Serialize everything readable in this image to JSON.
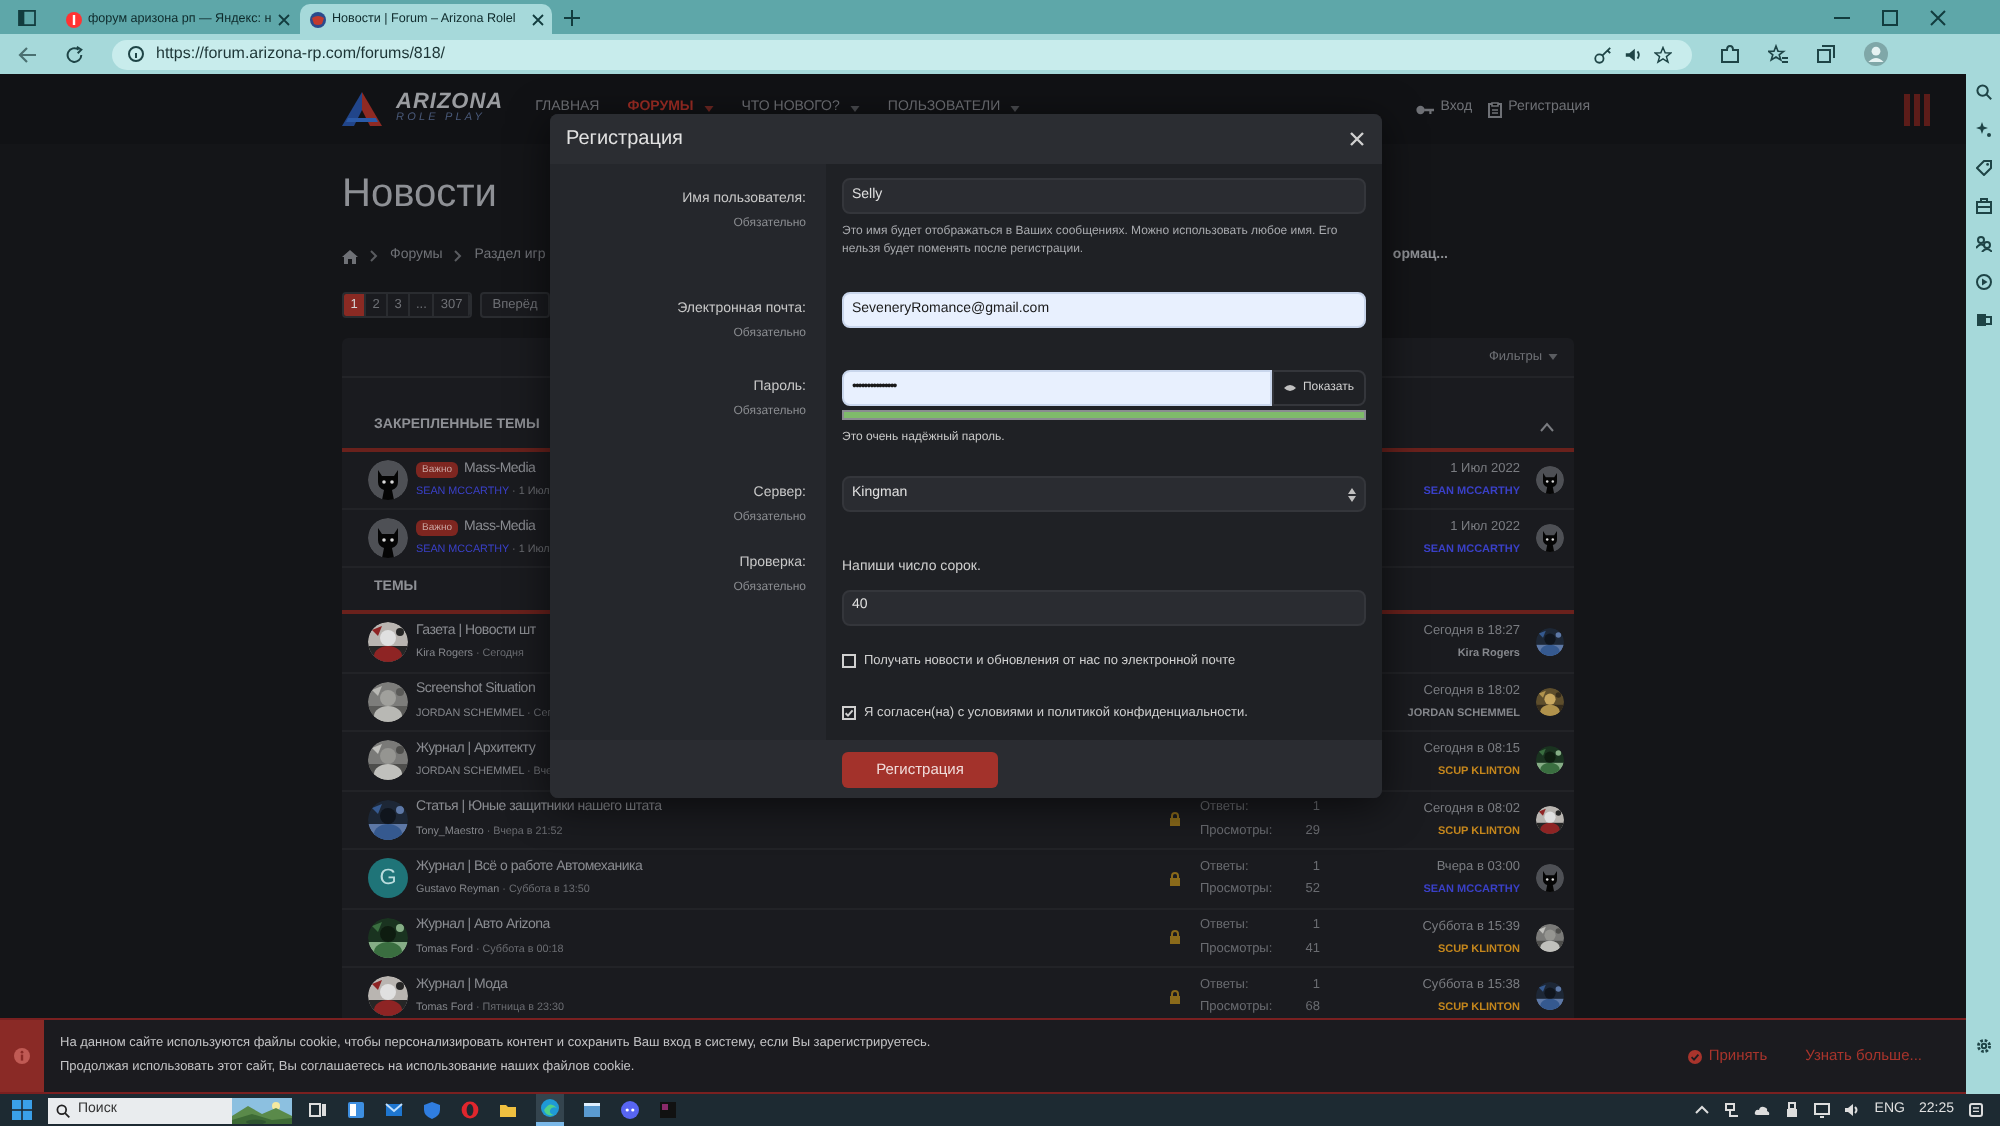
{
  "browser": {
    "tabs": [
      {
        "kind": "yandex",
        "title": "форум аризона рп — Яндекс: н",
        "selected": false
      },
      {
        "kind": "globe",
        "title": "Новости | Forum – Arizona Rolel",
        "selected": true
      }
    ],
    "url": "https://forum.arizona-rp.com/forums/818/"
  },
  "header": {
    "logo_title": "ARIZONA",
    "logo_subtitle": "ROLE PLAY",
    "nav": [
      {
        "label": "ГЛАВНАЯ",
        "selected": false,
        "dropdown": false
      },
      {
        "label": "ФОРУМЫ",
        "selected": true,
        "dropdown": true
      },
      {
        "label": "ЧТО НОВОГО?",
        "selected": false,
        "dropdown": true
      },
      {
        "label": "ПОЛЬЗОВАТЕЛИ",
        "selected": false,
        "dropdown": true
      }
    ],
    "login": "Вход",
    "register": "Регистрация"
  },
  "page_title": "Новости",
  "breadcrumbs": [
    "Форумы",
    "Раздел игр"
  ],
  "breadcrumb_tail": "ормац...",
  "pagination": {
    "pages": [
      {
        "label": "1",
        "selected": true
      },
      {
        "label": "2",
        "selected": false
      },
      {
        "label": "3",
        "selected": false
      },
      {
        "label": "...",
        "selected": false
      },
      {
        "label": "307",
        "selected": false
      }
    ],
    "next": "Вперёд"
  },
  "filters": "Фильтры",
  "pinned": {
    "heading": "ЗАКРЕПЛЕННЫЕ ТЕМЫ",
    "threads": [
      {
        "avatar": {
          "kind": "cat"
        },
        "badge": "Важно",
        "title": "Mass-Media",
        "author": {
          "name": "SEAN MCCARTHY",
          "color": "#3a40c8"
        },
        "date": "· 1 Июл",
        "last_date": "1 Июл 2022",
        "last_user": {
          "name": "SEAN MCCARTHY",
          "color": "#3a40c8"
        },
        "last_avatar": {
          "kind": "cat"
        }
      },
      {
        "avatar": {
          "kind": "cat"
        },
        "badge": "Важно",
        "title": "Mass-Media",
        "author": {
          "name": "SEAN MCCARTHY",
          "color": "#3a40c8"
        },
        "date": "· 1 Июл",
        "last_date": "1 Июл 2022",
        "last_user": {
          "name": "SEAN MCCARTHY",
          "color": "#3a40c8"
        },
        "last_avatar": {
          "kind": "cat"
        }
      }
    ]
  },
  "topics": {
    "heading": "ТЕМЫ",
    "threads": [
      {
        "title": "Газета | Новости шт",
        "author": {
          "name": "Kira Rogers",
          "color": "#85878c"
        },
        "date": "· Сегодня",
        "last_date": "Сегодня в 18:27",
        "last_user": {
          "name": "Kira Rogers",
          "color": "#85878c"
        }
      },
      {
        "title": "Screenshot Situation",
        "author": {
          "name": "JORDAN SCHEMMEL",
          "color": "#85878c"
        },
        "date": "· Сег",
        "last_date": "Сегодня в 18:02",
        "last_user": {
          "name": "JORDAN SCHEMMEL",
          "color": "#85878c"
        }
      },
      {
        "title": "Журнал | Архитекту",
        "author": {
          "name": "JORDAN SCHEMMEL",
          "color": "#85878c"
        },
        "date": "· Вче",
        "last_date": "Сегодня в 08:15",
        "last_user": {
          "name": "SCUP KLINTON",
          "color": "#c4861c"
        }
      },
      {
        "title": "Статья | Юные защитники нашего штата",
        "author": {
          "name": "Tony_Maestro",
          "color": "#85878c"
        },
        "date": "· Вчера в 21:52",
        "locked": true,
        "replies_label": "Ответы:",
        "replies": "1",
        "views_label": "Просмотры:",
        "views": "29",
        "last_date": "Сегодня в 08:02",
        "last_user": {
          "name": "SCUP KLINTON",
          "color": "#c4861c"
        }
      },
      {
        "avatar": {
          "kind": "letter",
          "letter": "G"
        },
        "title": "Журнал | Всё о работе Автомеханика",
        "author": {
          "name": "Gustavo Reyman",
          "color": "#85878c"
        },
        "date": "· Суббота в 13:50",
        "locked": true,
        "replies_label": "Ответы:",
        "replies": "1",
        "views_label": "Просмотры:",
        "views": "52",
        "last_date": "Вчера в 03:00",
        "last_user": {
          "name": "SEAN MCCARTHY",
          "color": "#3a40c8"
        },
        "last_avatar": {
          "kind": "cat"
        }
      },
      {
        "title": "Журнал | Авто Arizona",
        "author": {
          "name": "Tomas Ford",
          "color": "#85878c"
        },
        "date": "· Суббота в 00:18",
        "locked": true,
        "replies_label": "Ответы:",
        "replies": "1",
        "views_label": "Просмотры:",
        "views": "41",
        "last_date": "Суббота в 15:39",
        "last_user": {
          "name": "SCUP KLINTON",
          "color": "#c4861c"
        }
      },
      {
        "title": "Журнал | Мода",
        "author": {
          "name": "Tomas Ford",
          "color": "#85878c"
        },
        "date": "· Пятница в 23:30",
        "locked": true,
        "replies_label": "Ответы:",
        "replies": "1",
        "views_label": "Просмотры:",
        "views": "68",
        "last_date": "Суббота в 15:38",
        "last_user": {
          "name": "SCUP KLINTON",
          "color": "#c4861c"
        }
      }
    ]
  },
  "modal": {
    "title": "Регистрация",
    "fields": [
      {
        "kind": "text",
        "label": "Имя пользователя:",
        "required": "Обязательно",
        "value": "Selly",
        "autofilled": false,
        "hint": "Это имя будет отображаться в Ваших сообщениях. Можно использовать любое имя. Его нельзя будет поменять после регистрации."
      },
      {
        "kind": "text",
        "label": "Электронная почта:",
        "required": "Обязательно",
        "value": "SeveneryRomance@gmail.com",
        "autofilled": true
      },
      {
        "kind": "password",
        "label": "Пароль:",
        "required": "Обязательно",
        "value": "•••••••••••••••",
        "autofilled": true,
        "show_button": "Показать",
        "level": 1,
        "hint": "Это очень надёжный пароль."
      },
      {
        "kind": "select",
        "label": "Сервер:",
        "required": "Обязательно",
        "value": "Kingman",
        "autofilled": false
      },
      {
        "kind": "captcha",
        "label": "Проверка:",
        "required": "Обязательно",
        "question": "Напиши число сорок.",
        "value": "40",
        "autofilled": false
      }
    ],
    "checkboxes": [
      {
        "label": "Получать новости и обновления от нас по электронной почте",
        "checked": false
      },
      {
        "label": "Я согласен(на) с условиями и политикой конфиденциальности.",
        "checked": true
      }
    ],
    "submit": "Регистрация"
  },
  "cookie": {
    "lines": [
      "На данном сайте используются файлы cookie, чтобы персонализировать контент и сохранить Ваш вход в систему, если Вы зарегистрируетесь.",
      "Продолжая использовать этот сайт, Вы соглашаетесь на использование наших файлов cookie."
    ],
    "accept": "Принять",
    "more": "Узнать больше..."
  },
  "taskbar": {
    "search": "Поиск",
    "language": "ENG",
    "time": "22:25"
  }
}
